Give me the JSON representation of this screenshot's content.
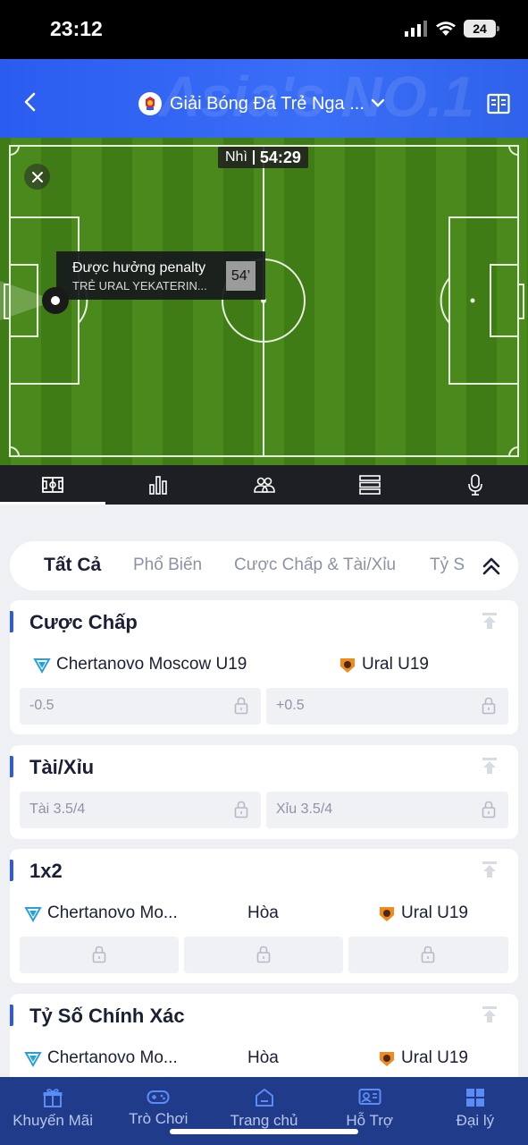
{
  "status": {
    "time": "23:12",
    "battery": "24"
  },
  "header": {
    "title": "Giải Bóng Đá Trẻ Nga ...",
    "watermark": "Asia's NO.1"
  },
  "match": {
    "period": "Nhì",
    "clock": "54:29",
    "event": {
      "title": "Được hưởng penalty",
      "team": "TRẺ URAL YEKATERIN...",
      "minute": "54’"
    }
  },
  "stats_tabs": [
    {
      "name": "pitch-icon"
    },
    {
      "name": "bar-chart-icon"
    },
    {
      "name": "lineup-icon"
    },
    {
      "name": "list-icon"
    },
    {
      "name": "microphone-icon"
    }
  ],
  "filters": [
    "Tất Cả",
    "Phổ Biến",
    "Cược Chấp & Tài/Xỉu",
    "Tỷ S"
  ],
  "teams": {
    "home": "Chertanovo Moscow U19",
    "home_short": "Chertanovo Mo...",
    "away": "Ural U19",
    "draw": "Hòa"
  },
  "markets": {
    "handicap": {
      "title": "Cược Chấp",
      "home_line": "-0.5",
      "away_line": "+0.5"
    },
    "totals": {
      "title": "Tài/Xỉu",
      "over": "Tài 3.5/4",
      "under": "Xỉu 3.5/4"
    },
    "one_x_two": {
      "title": "1x2"
    },
    "correct_score": {
      "title": "Tỷ Số Chính Xác"
    }
  },
  "nav": [
    {
      "label": "Khuyến Mãi",
      "icon": "gift-icon"
    },
    {
      "label": "Trò Chơi",
      "icon": "gamepad-icon"
    },
    {
      "label": "Trang chủ",
      "icon": "home-icon"
    },
    {
      "label": "Hỗ Trợ",
      "icon": "support-icon"
    },
    {
      "label": "Đại lý",
      "icon": "agent-icon"
    }
  ],
  "colors": {
    "primary": "#2e58e8",
    "pitch": "#3e7a14",
    "nav_bg": "#1f3b8a"
  }
}
